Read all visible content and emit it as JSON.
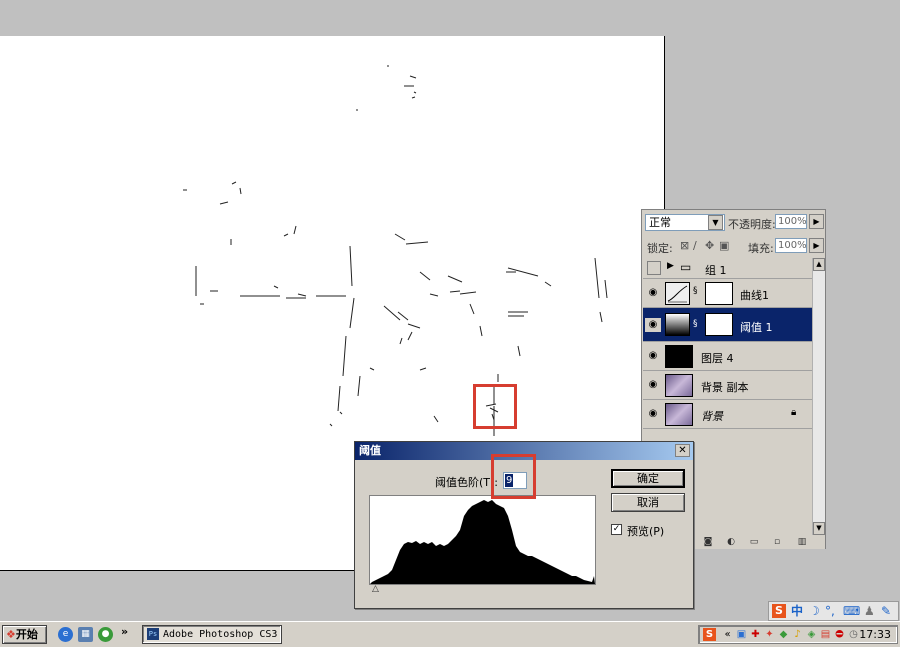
{
  "layers_panel": {
    "blend_mode": "正常",
    "opacity_label": "不透明度:",
    "opacity_value": "100%",
    "lock_label": "锁定:",
    "fill_label": "填充:",
    "fill_value": "100%",
    "layers": [
      {
        "name": "组 1",
        "type": "group"
      },
      {
        "name": "曲线1",
        "type": "curves"
      },
      {
        "name": "阈值 1",
        "type": "threshold",
        "selected": true
      },
      {
        "name": "图层 4",
        "type": "black"
      },
      {
        "name": "背景 副本",
        "type": "photo"
      },
      {
        "name": "背景",
        "type": "photo-locked"
      }
    ]
  },
  "dialog": {
    "title": "阈值",
    "threshold_label": "阈值色阶(T):",
    "threshold_value": "9",
    "ok_label": "确定",
    "cancel_label": "取消",
    "preview_label": "预览(P)",
    "preview_checked": "✓"
  },
  "taskbar": {
    "start_label": "开始",
    "task_label": "Adobe Photoshop CS3",
    "clock": "17:33"
  },
  "ime": {
    "ime_mode": "中"
  },
  "colors": {
    "highlight": "#d63d30",
    "selection": "#0a246a"
  }
}
